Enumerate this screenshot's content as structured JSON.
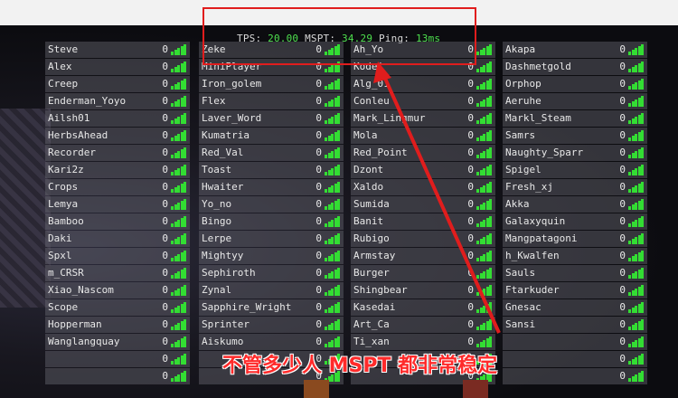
{
  "status_bar": {
    "tps_label": "TPS:",
    "tps_value": "20.00",
    "mspt_label": "MSPT:",
    "mspt_value": "34.29",
    "ping_label": "Ping:",
    "ping_value": "13ms"
  },
  "caption": "不管多少人 MSPT 都非常稳定",
  "colors": {
    "highlight_box": "#e01d1d",
    "caption": "#ff2a2a",
    "signal_bars": "#33dd33",
    "status_values": "#4ee04e"
  },
  "player_list": {
    "columns": [
      {
        "players": [
          {
            "name": "Steve",
            "ping": "0"
          },
          {
            "name": "Alex",
            "ping": "0"
          },
          {
            "name": "Creep",
            "ping": "0"
          },
          {
            "name": "Enderman_Yoyo",
            "ping": "0"
          },
          {
            "name": "Ailsh01",
            "ping": "0"
          },
          {
            "name": "HerbsAhead",
            "ping": "0"
          },
          {
            "name": "Recorder",
            "ping": "0"
          },
          {
            "name": "Kari2z",
            "ping": "0"
          },
          {
            "name": "Crops",
            "ping": "0"
          },
          {
            "name": "Lemya",
            "ping": "0"
          },
          {
            "name": "Bamboo",
            "ping": "0"
          },
          {
            "name": "Daki",
            "ping": "0"
          },
          {
            "name": "Spxl",
            "ping": "0"
          },
          {
            "name": "m_CRSR",
            "ping": "0"
          },
          {
            "name": "Xiao_Nascom",
            "ping": "0"
          },
          {
            "name": "Scope",
            "ping": "0"
          },
          {
            "name": "Hopperman",
            "ping": "0"
          },
          {
            "name": "Wanglangquay",
            "ping": "0"
          },
          {
            "name": "",
            "ping": "0"
          },
          {
            "name": "",
            "ping": "0"
          }
        ]
      },
      {
        "players": [
          {
            "name": "Zeke",
            "ping": "0"
          },
          {
            "name": "MiniPlayer",
            "ping": "0"
          },
          {
            "name": "Iron_golem",
            "ping": "0"
          },
          {
            "name": "Flex",
            "ping": "0"
          },
          {
            "name": "Laver_Word",
            "ping": "0"
          },
          {
            "name": "Kumatria",
            "ping": "0"
          },
          {
            "name": "Red_Val",
            "ping": "0"
          },
          {
            "name": "Toast",
            "ping": "0"
          },
          {
            "name": "Hwaiter",
            "ping": "0"
          },
          {
            "name": "Yo_no",
            "ping": "0"
          },
          {
            "name": "Bingo",
            "ping": "0"
          },
          {
            "name": "Lerpe",
            "ping": "0"
          },
          {
            "name": "Mightyy",
            "ping": "0"
          },
          {
            "name": "Sephiroth",
            "ping": "0"
          },
          {
            "name": "Zynal",
            "ping": "0"
          },
          {
            "name": "Sapphire_Wright",
            "ping": "0"
          },
          {
            "name": "Sprinter",
            "ping": "0"
          },
          {
            "name": "Aiskumo",
            "ping": "0"
          },
          {
            "name": "",
            "ping": "0"
          },
          {
            "name": "",
            "ping": "0"
          }
        ]
      },
      {
        "players": [
          {
            "name": "Ah_Yo",
            "ping": "0"
          },
          {
            "name": "Kodei",
            "ping": "0"
          },
          {
            "name": "Alg_01",
            "ping": "0"
          },
          {
            "name": "Conleu",
            "ping": "0"
          },
          {
            "name": "Mark_Lingmur",
            "ping": "0"
          },
          {
            "name": "Mola",
            "ping": "0"
          },
          {
            "name": "Red_Point",
            "ping": "0"
          },
          {
            "name": "Dzont",
            "ping": "0"
          },
          {
            "name": "Xaldo",
            "ping": "0"
          },
          {
            "name": "Sumida",
            "ping": "0"
          },
          {
            "name": "Banit",
            "ping": "0"
          },
          {
            "name": "Rubigo",
            "ping": "0"
          },
          {
            "name": "Armstay",
            "ping": "0"
          },
          {
            "name": "Burger",
            "ping": "0"
          },
          {
            "name": "Shingbear",
            "ping": "0"
          },
          {
            "name": "Kasedai",
            "ping": "0"
          },
          {
            "name": "Art_Ca",
            "ping": "0"
          },
          {
            "name": "Ti_xan",
            "ping": "0"
          },
          {
            "name": "",
            "ping": "0"
          },
          {
            "name": "",
            "ping": "0"
          }
        ]
      },
      {
        "players": [
          {
            "name": "Akapa",
            "ping": "0"
          },
          {
            "name": "Dashmetgold",
            "ping": "0"
          },
          {
            "name": "Orphop",
            "ping": "0"
          },
          {
            "name": "Aeruhe",
            "ping": "0"
          },
          {
            "name": "Markl_Steam",
            "ping": "0"
          },
          {
            "name": "Samrs",
            "ping": "0"
          },
          {
            "name": "Naughty_Sparr",
            "ping": "0"
          },
          {
            "name": "Spigel",
            "ping": "0"
          },
          {
            "name": "Fresh_xj",
            "ping": "0"
          },
          {
            "name": "Akka",
            "ping": "0"
          },
          {
            "name": "Galaxyquin",
            "ping": "0"
          },
          {
            "name": "Mangpatagoni",
            "ping": "0"
          },
          {
            "name": "h_Kwalfen",
            "ping": "0"
          },
          {
            "name": "Sauls",
            "ping": "0"
          },
          {
            "name": "Ftarkuder",
            "ping": "0"
          },
          {
            "name": "Gnesac",
            "ping": "0"
          },
          {
            "name": "Sansi",
            "ping": "0"
          },
          {
            "name": "",
            "ping": "0"
          },
          {
            "name": "",
            "ping": "0"
          },
          {
            "name": "",
            "ping": "0"
          }
        ]
      }
    ]
  }
}
